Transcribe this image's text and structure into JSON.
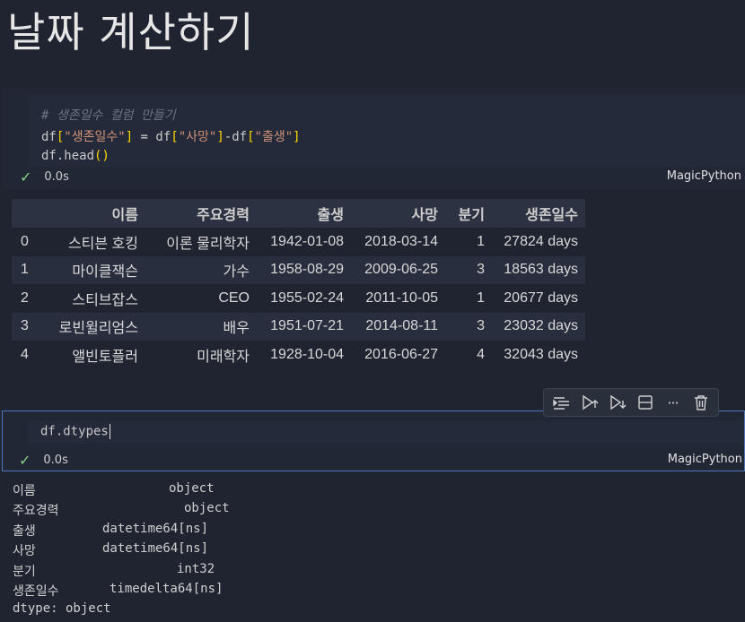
{
  "title": "날짜 계산하기",
  "cell1": {
    "comment_prefix": "# 생존일수 컬럼 ",
    "comment_selected": "만들기",
    "line2": {
      "a": "df",
      "b": "[",
      "c": "\"생존일수\"",
      "d": "]",
      "e": " = ",
      "f": "df",
      "g": "[",
      "h": "\"사망\"",
      "i": "]",
      "j": "-",
      "k": "df",
      "l": "[",
      "m": "\"출생\"",
      "n": "]"
    },
    "line3": {
      "a": "df.head",
      "b": "()"
    },
    "status_time": "0.0s",
    "language": "MagicPython"
  },
  "table": {
    "columns": [
      "",
      "이름",
      "주요경력",
      "출생",
      "사망",
      "분기",
      "생존일수"
    ],
    "rows": [
      [
        "0",
        "스티븐 호킹",
        "이론 물리학자",
        "1942-01-08",
        "2018-03-14",
        "1",
        "27824 days"
      ],
      [
        "1",
        "마이클잭슨",
        "가수",
        "1958-08-29",
        "2009-06-25",
        "3",
        "18563 days"
      ],
      [
        "2",
        "스티브잡스",
        "CEO",
        "1955-02-24",
        "2011-10-05",
        "1",
        "20677 days"
      ],
      [
        "3",
        "로빈윌리엄스",
        "배우",
        "1951-07-21",
        "2014-08-11",
        "3",
        "23032 days"
      ],
      [
        "4",
        "앨빈토플러",
        "미래학자",
        "1928-10-04",
        "2016-06-27",
        "4",
        "32043 days"
      ]
    ]
  },
  "toolbar": {
    "icons": [
      "run-by-line-icon",
      "execute-above-icon",
      "execute-below-icon",
      "split-cell-icon",
      "more-icon",
      "delete-icon"
    ],
    "more_glyph": "···"
  },
  "cell2": {
    "code": "df.dtypes",
    "status_time": "0.0s",
    "language": "MagicPython"
  },
  "output": {
    "rows": [
      {
        "key": "이름",
        "value": "object",
        "vcol": 174
      },
      {
        "key": "주요경력",
        "value": "object",
        "vcol": 191
      },
      {
        "key": "출생",
        "value": "datetime64[ns]",
        "vcol": 100
      },
      {
        "key": "사망",
        "value": "datetime64[ns]",
        "vcol": 100
      },
      {
        "key": "분기",
        "value": "int32",
        "vcol": 183
      },
      {
        "key": "생존일수",
        "value": "timedelta64[ns]",
        "vcol": 108
      }
    ],
    "footer": "dtype: object"
  }
}
